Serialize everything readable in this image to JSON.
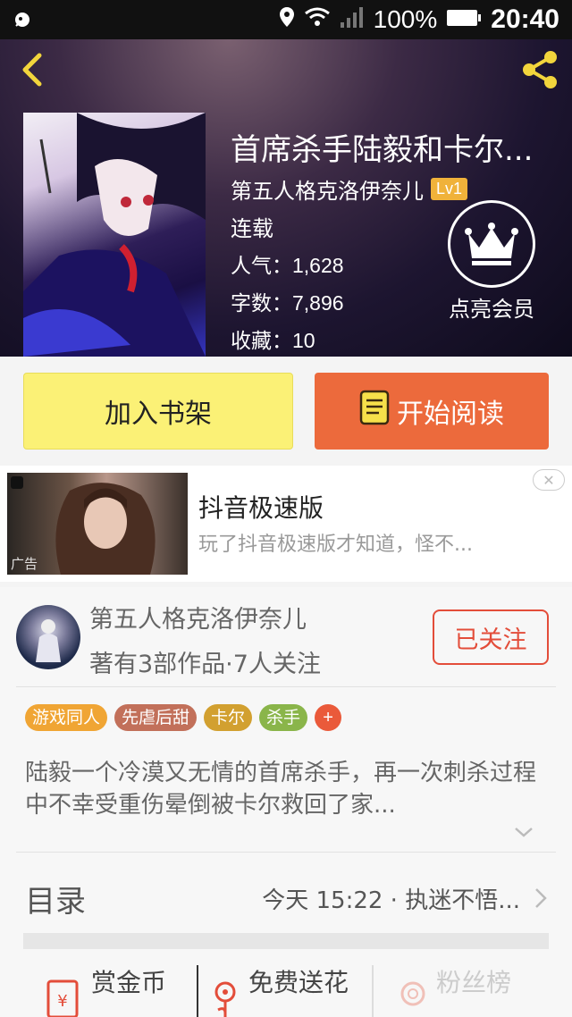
{
  "status_bar": {
    "battery_pct": "100%",
    "time": "20:40"
  },
  "book": {
    "title": "首席杀手陆毅和卡尔...",
    "author": "第五人格克洛伊奈儿",
    "level": "Lv1",
    "status": "连载",
    "stats": [
      {
        "label": "人气：",
        "value": "1,628"
      },
      {
        "label": "字数：",
        "value": "7,896"
      },
      {
        "label": "收藏：",
        "value": "10"
      }
    ],
    "vip_label": "点亮会员"
  },
  "actions": {
    "add_shelf": "加入书架",
    "start_read": "开始阅读"
  },
  "ad": {
    "title": "抖音极速版",
    "desc": "玩了抖音极速版才知道，怪不...",
    "tag": "广告"
  },
  "author_card": {
    "name": "第五人格克洛伊奈儿",
    "meta": "著有3部作品·7人关注",
    "follow_label": "已关注",
    "tags": [
      {
        "label": "游戏同人",
        "color": "#f0a534"
      },
      {
        "label": "先虐后甜",
        "color": "#c2705a"
      },
      {
        "label": "卡尔",
        "color": "#d2a030"
      },
      {
        "label": "杀手",
        "color": "#8ab54a"
      }
    ],
    "tag_plus": "+",
    "description": "陆毅一个冷漠又无情的首席杀手，再一次刺杀过程中不幸受重伤晕倒被卡尔救回了家..."
  },
  "toc": {
    "label": "目录",
    "latest": "今天 15:22 · 执迷不悟..."
  },
  "bottom_bar": {
    "reward": "赏金币",
    "flower": "免费送花",
    "fans": "粉丝榜"
  },
  "colors": {
    "accent_orange": "#ec6a3c",
    "shelf_yellow": "#fbf176",
    "follow_red": "#e34d3a",
    "share_yellow": "#f2d53c"
  }
}
